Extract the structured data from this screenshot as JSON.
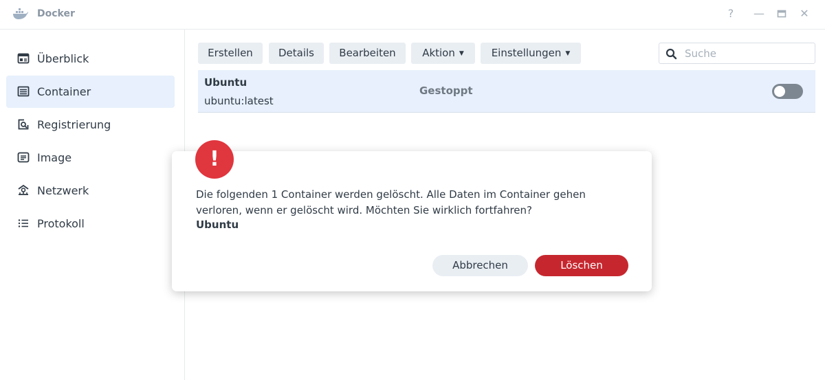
{
  "app": {
    "title": "Docker"
  },
  "window_controls": {
    "help": "?",
    "minimize": "—",
    "maximize": "▭",
    "close": "✕"
  },
  "sidebar": {
    "items": [
      {
        "label": "Überblick",
        "icon": "overview-icon",
        "active": false
      },
      {
        "label": "Container",
        "icon": "container-list-icon",
        "active": true
      },
      {
        "label": "Registrierung",
        "icon": "registry-search-icon",
        "active": false
      },
      {
        "label": "Image",
        "icon": "image-icon",
        "active": false
      },
      {
        "label": "Netzwerk",
        "icon": "network-icon",
        "active": false
      },
      {
        "label": "Protokoll",
        "icon": "log-list-icon",
        "active": false
      }
    ]
  },
  "toolbar": {
    "create": "Erstellen",
    "details": "Details",
    "edit": "Bearbeiten",
    "action": "Aktion",
    "settings": "Einstellungen"
  },
  "search": {
    "placeholder": "Suche",
    "value": ""
  },
  "containers": [
    {
      "name": "Ubuntu",
      "image": "ubuntu:latest",
      "status": "Gestoppt",
      "running": false
    }
  ],
  "dialog": {
    "icon": "warning-icon",
    "icon_glyph": "!",
    "message": "Die folgenden 1 Container werden gelöscht. Alle Daten im Container gehen verloren, wenn er gelöscht wird. Möchten Sie wirklich fortfahren?",
    "target": "Ubuntu",
    "cancel": "Abbrechen",
    "confirm": "Löschen"
  },
  "colors": {
    "accent_selected": "#e7f0fc",
    "danger": "#c6272e",
    "warning_icon": "#e0363e",
    "button_bg": "#e9eef3"
  }
}
